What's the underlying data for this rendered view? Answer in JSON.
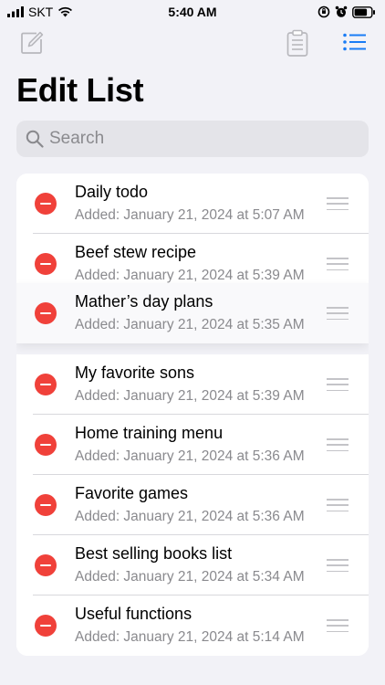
{
  "status_bar": {
    "carrier": "SKT",
    "time": "5:40 AM"
  },
  "toolbar": {
    "compose_icon": "compose-icon",
    "clipboard_icon": "clipboard-icon",
    "list_icon": "list-icon"
  },
  "page": {
    "title": "Edit List"
  },
  "search": {
    "placeholder": "Search",
    "value": ""
  },
  "colors": {
    "accent": "#1a7cf5",
    "delete": "#f0413a",
    "background": "#f2f2f7"
  },
  "list": {
    "items": [
      {
        "title": "Daily todo",
        "subtitle": "Added: January 21, 2024 at 5:07 AM"
      },
      {
        "title": "Beef stew recipe",
        "subtitle": "Added: January 21, 2024 at 5:39 AM"
      },
      {
        "title": "Mather’s day plans",
        "subtitle": "Added: January 21, 2024 at 5:35 AM"
      },
      {
        "title": "My favorite sons",
        "subtitle": "Added: January 21, 2024 at 5:39 AM"
      },
      {
        "title": "Home training menu",
        "subtitle": "Added: January 21, 2024 at 5:36 AM"
      },
      {
        "title": "Favorite games",
        "subtitle": "Added: January 21, 2024 at 5:36 AM"
      },
      {
        "title": "Best selling books list",
        "subtitle": "Added: January 21, 2024 at 5:34 AM"
      },
      {
        "title": "Useful functions",
        "subtitle": "Added: January 21, 2024 at 5:14 AM"
      }
    ]
  }
}
